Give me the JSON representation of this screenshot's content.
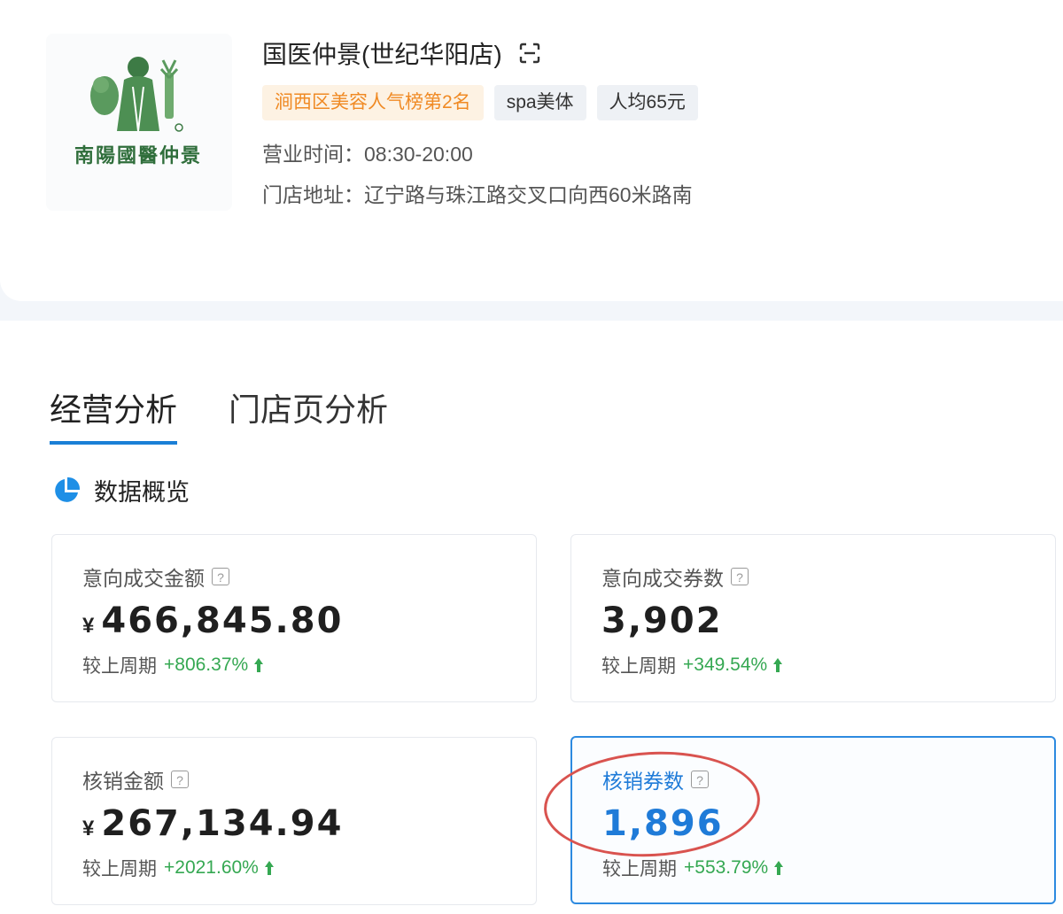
{
  "store": {
    "logo_text": "南陽國醫仲景",
    "name": "国医仲景(世纪华阳店)",
    "tags": [
      "涧西区美容人气榜第2名",
      "spa美体",
      "人均65元"
    ],
    "hours_label": "营业时间：",
    "hours": "08:30-20:00",
    "address_label": "门店地址：",
    "address": "辽宁路与珠江路交叉口向西60米路南"
  },
  "tabs": [
    "经营分析",
    "门店页分析"
  ],
  "section_title": "数据概览",
  "metrics": [
    {
      "label": "意向成交金额",
      "currency": "¥",
      "value": "466,845.80",
      "compare_label": "较上周期",
      "compare_value": "+806.37%"
    },
    {
      "label": "意向成交券数",
      "currency": "",
      "value": "3,902",
      "compare_label": "较上周期",
      "compare_value": "+349.54%"
    },
    {
      "label": "核销金额",
      "currency": "¥",
      "value": "267,134.94",
      "compare_label": "较上周期",
      "compare_value": "+2021.60%"
    },
    {
      "label": "核销券数",
      "currency": "",
      "value": "1,896",
      "compare_label": "较上周期",
      "compare_value": "+553.79%"
    }
  ],
  "help_glyph": "?",
  "colors": {
    "accent": "#1f7bd8",
    "positive": "#35a852",
    "rank_tag": "#f08a24",
    "annotation": "#d9534f"
  }
}
